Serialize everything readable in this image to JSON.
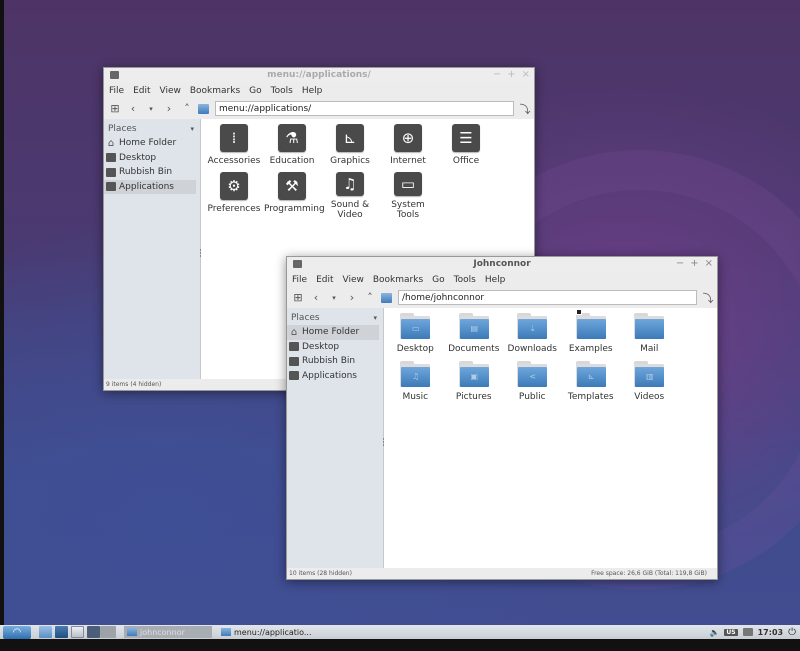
{
  "colors": {
    "accent": "#3e7bbd",
    "folder_top": "#6fa6dc",
    "app_icon_bg": "#4a4a4a",
    "sidebar_bg": "#dfe4ea"
  },
  "window_applications": {
    "title": "menu://applications/",
    "window_buttons": {
      "minimize": "−",
      "maximize": "+",
      "close": "×"
    },
    "menu": [
      "File",
      "Edit",
      "View",
      "Bookmarks",
      "Go",
      "Tools",
      "Help"
    ],
    "address": "menu://applications/",
    "sidebar": {
      "header": "Places",
      "items": [
        {
          "label": "Home Folder",
          "icon": "home-icon",
          "selected": false
        },
        {
          "label": "Desktop",
          "icon": "desktop-icon",
          "selected": false
        },
        {
          "label": "Rubbish Bin",
          "icon": "trash-icon",
          "selected": false
        },
        {
          "label": "Applications",
          "icon": "applications-icon",
          "selected": true
        }
      ]
    },
    "items": [
      {
        "label": "Accessories",
        "icon": "accessories-icon",
        "glyph": "⁞"
      },
      {
        "label": "Education",
        "icon": "flask-icon",
        "glyph": "⚗"
      },
      {
        "label": "Graphics",
        "icon": "graphics-icon",
        "glyph": "⊾"
      },
      {
        "label": "Internet",
        "icon": "globe-icon",
        "glyph": "⊕"
      },
      {
        "label": "Office",
        "icon": "document-icon",
        "glyph": "☰"
      },
      {
        "label": "Preferences",
        "icon": "gear-icon",
        "glyph": "⚙"
      },
      {
        "label": "Programming",
        "icon": "construction-icon",
        "glyph": "⚒"
      },
      {
        "label": "Sound & Video",
        "icon": "media-icon",
        "glyph": "♫"
      },
      {
        "label": "System Tools",
        "icon": "monitor-icon",
        "glyph": "▭"
      }
    ],
    "status": "9 items (4 hidden)"
  },
  "window_home": {
    "title": "Johnconnor",
    "window_buttons": {
      "minimize": "−",
      "maximize": "+",
      "close": "×"
    },
    "menu": [
      "File",
      "Edit",
      "View",
      "Bookmarks",
      "Go",
      "Tools",
      "Help"
    ],
    "address": "/home/johnconnor",
    "sidebar": {
      "header": "Places",
      "items": [
        {
          "label": "Home Folder",
          "icon": "home-icon",
          "selected": true
        },
        {
          "label": "Desktop",
          "icon": "desktop-icon",
          "selected": false
        },
        {
          "label": "Rubbish Bin",
          "icon": "trash-icon",
          "selected": false
        },
        {
          "label": "Applications",
          "icon": "applications-icon",
          "selected": false
        }
      ]
    },
    "items": [
      {
        "label": "Desktop",
        "icon": "folder-desktop-icon",
        "glyph": "▭",
        "link": false
      },
      {
        "label": "Documents",
        "icon": "folder-documents-icon",
        "glyph": "▤",
        "link": false
      },
      {
        "label": "Downloads",
        "icon": "folder-downloads-icon",
        "glyph": "⤓",
        "link": false
      },
      {
        "label": "Examples",
        "icon": "folder-icon",
        "glyph": "",
        "link": true
      },
      {
        "label": "Mail",
        "icon": "folder-icon",
        "glyph": "",
        "link": false
      },
      {
        "label": "Music",
        "icon": "folder-music-icon",
        "glyph": "♫",
        "link": false
      },
      {
        "label": "Pictures",
        "icon": "folder-pictures-icon",
        "glyph": "▣",
        "link": false
      },
      {
        "label": "Public",
        "icon": "folder-public-icon",
        "glyph": "<",
        "link": false
      },
      {
        "label": "Templates",
        "icon": "folder-templates-icon",
        "glyph": "⊾",
        "link": false
      },
      {
        "label": "Videos",
        "icon": "folder-videos-icon",
        "glyph": "▥",
        "link": false
      }
    ],
    "status_left": "10 items (28 hidden)",
    "status_right": "Free space: 26,6 GiB (Total: 119,8 GiB)"
  },
  "taskbar": {
    "tasks": [
      {
        "label": "johnconnor",
        "active": true
      },
      {
        "label": "menu://applicatio...",
        "active": false
      }
    ],
    "keyboard_layout": "US",
    "clock": "17:03"
  }
}
